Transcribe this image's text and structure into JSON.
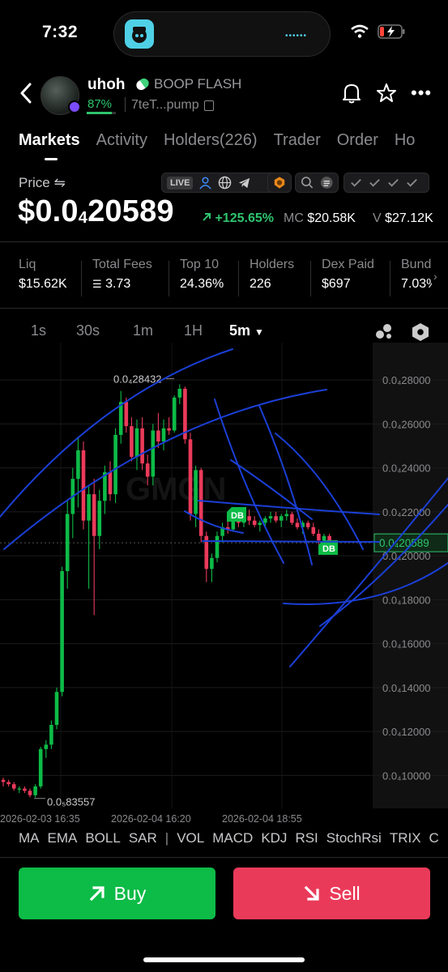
{
  "status_bar": {
    "time": "7:32"
  },
  "header": {
    "token_name": "uhoh",
    "flash_label": "BOOP FLASH",
    "progress_pct": "87%",
    "progress_value": 0.87,
    "address": "7teT...pump"
  },
  "tabs": [
    "Markets",
    "Activity",
    "Holders(226)",
    "Trader",
    "Order",
    "Ho"
  ],
  "price": {
    "label": "Price ⇋",
    "prefix": "$0.0",
    "subscript": "4",
    "digits": "20589",
    "change": "+125.65%",
    "mc_label": "MC",
    "mc_value": "$20.58K",
    "vol_label": "V",
    "vol_value": "$27.12K",
    "live_tag": "LIVE"
  },
  "stats": [
    {
      "label": "Liq",
      "value": "$15.62K"
    },
    {
      "label": "Total Fees",
      "value": "3.73"
    },
    {
      "label": "Top 10",
      "value": "24.36%"
    },
    {
      "label": "Holders",
      "value": "226"
    },
    {
      "label": "Dex Paid",
      "value": "$697"
    },
    {
      "label": "Bund",
      "value": "7.03%"
    }
  ],
  "intervals": [
    "1s",
    "30s",
    "1m",
    "1H",
    "5m"
  ],
  "active_interval": "5m",
  "indicators": [
    "MA",
    "EMA",
    "BOLL",
    "SAR",
    "|",
    "VOL",
    "MACD",
    "KDJ",
    "RSI",
    "StochRsi",
    "TRIX",
    "C"
  ],
  "buttons": {
    "buy": "Buy",
    "sell": "Sell"
  },
  "colors": {
    "up": "#0dbb47",
    "down": "#ea3a5a",
    "accent_green": "#2ec46d",
    "annotation": "#1b3fd6"
  },
  "chart_data": {
    "type": "candlestick",
    "y_ticks": [
      "0.0₄28000",
      "0.0₄26000",
      "0.0₄24000",
      "0.0₄22000",
      "0.0₄20000",
      "0.0₄18000",
      "0.0₄16000",
      "0.0₄14000",
      "0.0₄12000",
      "0.0₄10000"
    ],
    "y_tick_values": [
      2.8e-05,
      2.6e-05,
      2.4e-05,
      2.2e-05,
      2e-05,
      1.8e-05,
      1.6e-05,
      1.4e-05,
      1.2e-05,
      1e-05
    ],
    "ylim": [
      8.5e-06,
      2.97e-05
    ],
    "x_ticks": [
      "2026-02-03 16:35",
      "2026-02-04 16:20",
      "2026-02-04 18:55"
    ],
    "current_price_label": "0.0₄20589",
    "current_price": 2.05889e-05,
    "high_label": "0.0₄28432",
    "high_value": 2.78e-05,
    "low_label": "0.0₅83557",
    "low_value": 9.1e-06,
    "markers": [
      "DB",
      "DB"
    ],
    "candles": [
      [
        9.8e-06,
        9.9e-06,
        9.5e-06,
        9.7e-06
      ],
      [
        9.7e-06,
        9.8e-06,
        9.5e-06,
        9.6e-06
      ],
      [
        9.6e-06,
        9.7e-06,
        9.3e-06,
        9.4e-06
      ],
      [
        9.4e-06,
        9.5e-06,
        9.2e-06,
        9.4e-06
      ],
      [
        9.4e-06,
        9.5e-06,
        9.2e-06,
        9.3e-06
      ],
      [
        9.3e-06,
        9.4e-06,
        9e-06,
        9.1e-06
      ],
      [
        9.1e-06,
        9.6e-06,
        9e-06,
        9.5e-06
      ],
      [
        9.5e-06,
        1.13e-05,
        9.4e-06,
        1.12e-05
      ],
      [
        1.12e-05,
        1.16e-05,
        1.08e-05,
        1.14e-05
      ],
      [
        1.14e-05,
        1.25e-05,
        1.12e-05,
        1.23e-05
      ],
      [
        1.23e-05,
        1.4e-05,
        1.21e-05,
        1.38e-05
      ],
      [
        1.38e-05,
        1.95e-05,
        1.36e-05,
        1.93e-05
      ],
      [
        1.93e-05,
        2.25e-05,
        1.85e-05,
        2.19e-05
      ],
      [
        2.19e-05,
        2.4e-05,
        2.08e-05,
        2.35e-05
      ],
      [
        2.35e-05,
        2.54e-05,
        2.22e-05,
        2.48e-05
      ],
      [
        2.48e-05,
        2.52e-05,
        2.12e-05,
        2.16e-05
      ],
      [
        2.16e-05,
        2.32e-05,
        1.85e-05,
        2.28e-05
      ],
      [
        2.28e-05,
        2.35e-05,
        1.73e-05,
        2.09e-05
      ],
      [
        2.09e-05,
        2.3e-05,
        2.03e-05,
        2.25e-05
      ],
      [
        2.25e-05,
        2.41e-05,
        2.19e-05,
        2.38e-05
      ],
      [
        2.38e-05,
        2.43e-05,
        2.25e-05,
        2.28e-05
      ],
      [
        2.28e-05,
        2.58e-05,
        2.24e-05,
        2.55e-05
      ],
      [
        2.55e-05,
        2.75e-05,
        2.51e-05,
        2.7e-05
      ],
      [
        2.7e-05,
        2.72e-05,
        2.56e-05,
        2.59e-05
      ],
      [
        2.59e-05,
        2.63e-05,
        2.43e-05,
        2.45e-05
      ],
      [
        2.45e-05,
        2.62e-05,
        2.39e-05,
        2.58e-05
      ],
      [
        2.58e-05,
        2.63e-05,
        2.39e-05,
        2.42e-05
      ],
      [
        2.42e-05,
        2.46e-05,
        2.32e-05,
        2.36e-05
      ],
      [
        2.36e-05,
        2.6e-05,
        2.32e-05,
        2.57e-05
      ],
      [
        2.57e-05,
        2.65e-05,
        2.49e-05,
        2.52e-05
      ],
      [
        2.52e-05,
        2.62e-05,
        2.48e-05,
        2.58e-05
      ],
      [
        2.58e-05,
        2.63e-05,
        2.55e-05,
        2.57e-05
      ],
      [
        2.57e-05,
        2.73e-05,
        2.56e-05,
        2.72e-05
      ],
      [
        2.72e-05,
        2.78e-05,
        2.69e-05,
        2.76e-05
      ],
      [
        2.76e-05,
        2.77e-05,
        2.51e-05,
        2.53e-05
      ],
      [
        2.53e-05,
        2.56e-05,
        2.16e-05,
        2.19e-05
      ],
      [
        2.19e-05,
        2.41e-05,
        2.13e-05,
        2.39e-05
      ],
      [
        2.39e-05,
        2.4e-05,
        2.06e-05,
        2.09e-05
      ],
      [
        2.09e-05,
        2.11e-05,
        1.88e-05,
        1.94e-05
      ],
      [
        1.94e-05,
        2.01e-05,
        1.88e-05,
        1.99e-05
      ],
      [
        1.99e-05,
        2.11e-05,
        1.97e-05,
        2.09e-05
      ],
      [
        2.09e-05,
        2.15e-05,
        2.06e-05,
        2.13e-05
      ],
      [
        2.13e-05,
        2.16e-05,
        2.1e-05,
        2.12e-05
      ],
      [
        2.12e-05,
        2.19e-05,
        2.11e-05,
        2.17e-05
      ],
      [
        2.17e-05,
        2.2e-05,
        2.13e-05,
        2.15e-05
      ],
      [
        2.15e-05,
        2.19e-05,
        2.13e-05,
        2.18e-05
      ],
      [
        2.18e-05,
        2.21e-05,
        2.14e-05,
        2.16e-05
      ],
      [
        2.16e-05,
        2.18e-05,
        2.13e-05,
        2.14e-05
      ],
      [
        2.14e-05,
        2.16e-05,
        2.11e-05,
        2.15e-05
      ],
      [
        2.15e-05,
        2.18e-05,
        2.13e-05,
        2.17e-05
      ],
      [
        2.17e-05,
        2.2e-05,
        2.15e-05,
        2.18e-05
      ],
      [
        2.18e-05,
        2.2e-05,
        2.15e-05,
        2.16e-05
      ],
      [
        2.16e-05,
        2.19e-05,
        2.13e-05,
        2.18e-05
      ],
      [
        2.18e-05,
        2.21e-05,
        2.16e-05,
        2.19e-05
      ],
      [
        2.19e-05,
        2.2e-05,
        2.14e-05,
        2.15e-05
      ],
      [
        2.15e-05,
        2.17e-05,
        2.12e-05,
        2.13e-05
      ],
      [
        2.13e-05,
        2.16e-05,
        2.1e-05,
        2.15e-05
      ],
      [
        2.15e-05,
        2.16e-05,
        2.12e-05,
        2.13e-05
      ],
      [
        2.13e-05,
        2.15e-05,
        2.09e-05,
        2.1e-05
      ],
      [
        2.1e-05,
        2.12e-05,
        2.05e-05,
        2.07e-05
      ],
      [
        2.07e-05,
        2.1e-05,
        2.03e-05,
        2.09e-05
      ],
      [
        2.09e-05,
        2.1e-05,
        2.02e-05,
        2.03e-05
      ],
      [
        2.03e-05,
        2.06e-05,
        2.01e-05,
        2.05e-05
      ]
    ]
  }
}
